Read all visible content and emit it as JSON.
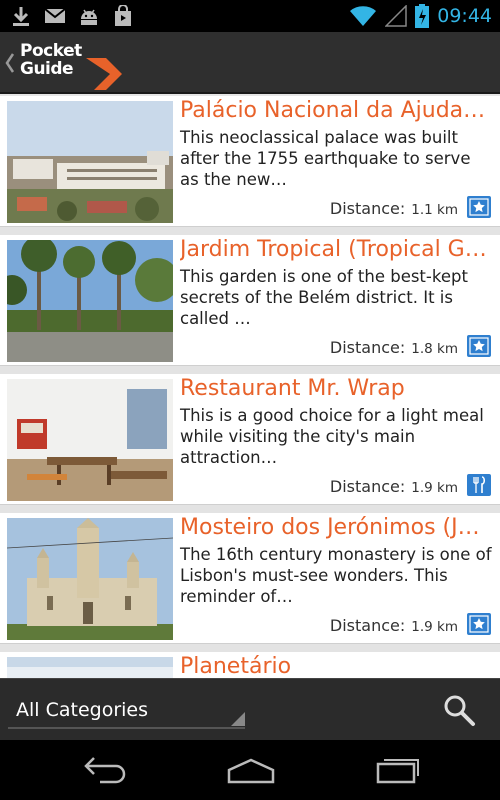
{
  "status_bar": {
    "time": "09:44",
    "left_icons": [
      "download-icon",
      "gmail-icon",
      "android-icon",
      "shopping-bag-icon"
    ],
    "right_icons": [
      "wifi-icon",
      "signal-icon",
      "battery-charging-icon"
    ]
  },
  "action_bar": {
    "logo_line1": "Pocket",
    "logo_line2": "Guide",
    "brand_color": "#e8622a"
  },
  "list": {
    "items": [
      {
        "title": "Palácio Nacional da Ajuda (…",
        "description": "This neoclassical palace was built after the 1755 earthquake to serve as the new…",
        "distance_label": "Distance:",
        "distance_value": "1.1 km",
        "category_icon": "star-icon"
      },
      {
        "title": "Jardim Tropical (Tropical Ga…",
        "description": "This garden is one of the best-kept secrets of the Belém district. It is called …",
        "distance_label": "Distance:",
        "distance_value": "1.8 km",
        "category_icon": "star-icon"
      },
      {
        "title": "Restaurant Mr. Wrap",
        "description": "This is a good choice for a light meal while visiting the city's main attraction…",
        "distance_label": "Distance:",
        "distance_value": "1.9 km",
        "category_icon": "fork-knife-icon"
      },
      {
        "title": "Mosteiro dos Jerónimos (Je…",
        "description": "The 16th century monastery is one of Lisbon's must-see wonders. This reminder of…",
        "distance_label": "Distance:",
        "distance_value": "1.9 km",
        "category_icon": "star-icon"
      },
      {
        "title": "Planetário"
      }
    ]
  },
  "bottom_bar": {
    "category_select_value": "All Categories"
  },
  "nav_bar": {
    "buttons": [
      "back-icon",
      "home-icon",
      "recents-icon"
    ]
  },
  "colors": {
    "title_orange": "#e8622a",
    "category_blue": "#2f7fcf",
    "status_time_blue": "#33b5e5"
  }
}
